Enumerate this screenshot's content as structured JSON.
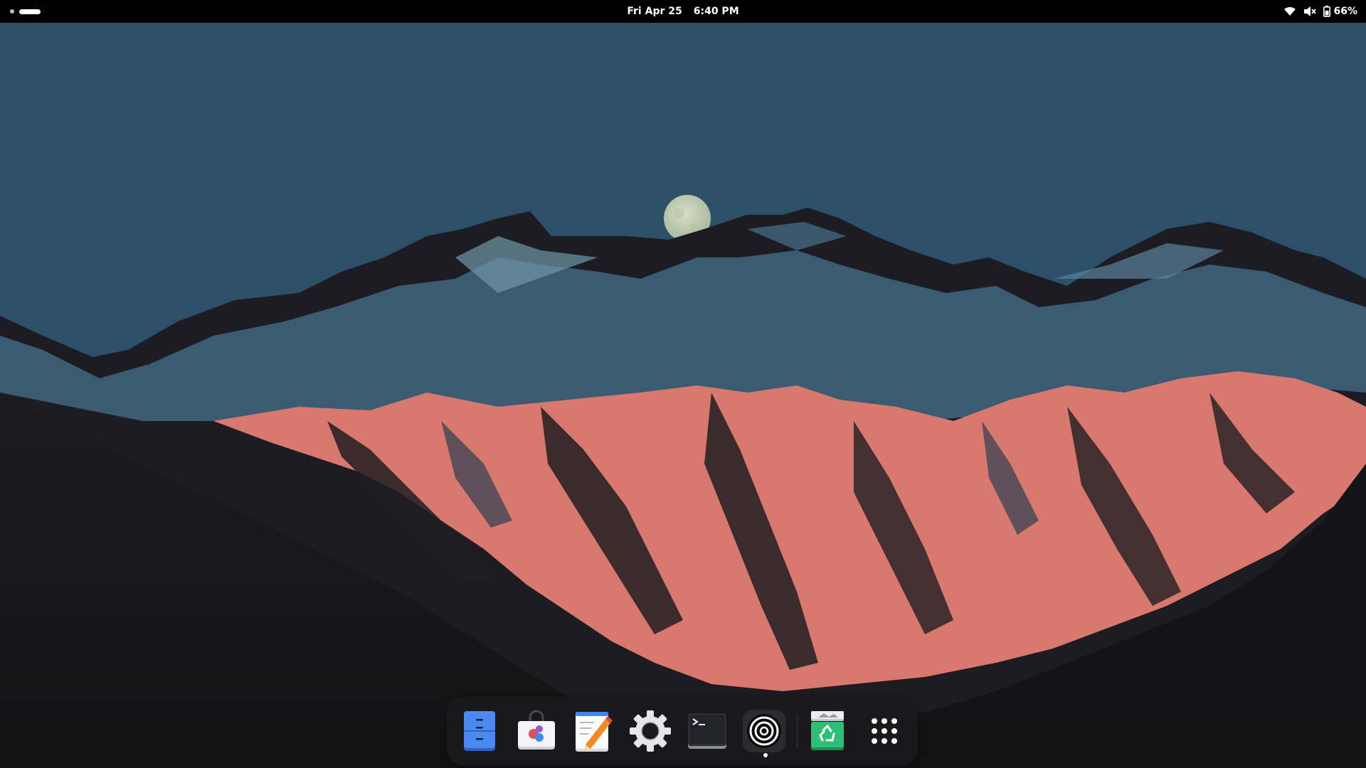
{
  "topbar": {
    "date": "Fri Apr 25",
    "time": "6:40 PM",
    "battery_percent": "66%",
    "tray_icons": [
      "wifi-icon",
      "volume-muted-icon",
      "battery-icon"
    ],
    "workspaces": {
      "count": 2,
      "active": 2
    }
  },
  "wallpaper": {
    "description_icons": [
      "moon",
      "mountains"
    ],
    "colors": {
      "sky": "#2d5069",
      "rock_dark": "#1b1a1e",
      "alpenglow": "#d9786f",
      "snow_blue": "#4f7f9b",
      "moon": "#c9d4b6"
    }
  },
  "dock": {
    "items": [
      {
        "name": "files",
        "icon": "files-icon",
        "running": false
      },
      {
        "name": "software-store",
        "icon": "store-bag-icon",
        "running": false
      },
      {
        "name": "text-editor",
        "icon": "text-editor-icon",
        "running": false
      },
      {
        "name": "settings",
        "icon": "gear-icon",
        "running": false
      },
      {
        "name": "terminal",
        "icon": "terminal-icon",
        "running": false
      },
      {
        "name": "disk-usage",
        "icon": "concentric-circles-icon",
        "running": true
      },
      {
        "name": "trash",
        "icon": "trash-recycle-icon",
        "running": false
      },
      {
        "name": "show-apps",
        "icon": "app-grid-icon",
        "running": false
      }
    ],
    "colors": {
      "background": "#1a1a1c",
      "files": "#3d7de3",
      "trash": "#27b06b"
    }
  }
}
